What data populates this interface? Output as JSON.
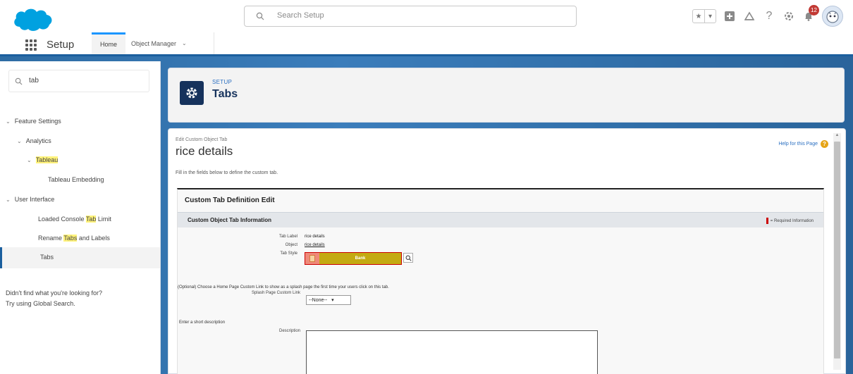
{
  "search": {
    "placeholder": "Search Setup"
  },
  "header": {
    "notification_count": "12"
  },
  "app_nav": {
    "app_name": "Setup",
    "tabs": [
      {
        "label": "Home"
      },
      {
        "label": "Object Manager"
      }
    ]
  },
  "sidebar": {
    "quick_find_value": "tab",
    "tree": {
      "feature_settings": "Feature Settings",
      "analytics": "Analytics",
      "tableau": "Tableau",
      "tableau_embedding": "Tableau Embedding",
      "user_interface": "User Interface",
      "loaded_console_prefix": "Loaded Console ",
      "loaded_console_hl": "Tab",
      "loaded_console_suffix": " Limit",
      "rename_prefix": "Rename ",
      "rename_hl": "Tabs",
      "rename_suffix": " and Labels",
      "tabs": "Tabs"
    },
    "help_line1": "Didn't find what you're looking for?",
    "help_line2": "Try using Global Search."
  },
  "setup_header": {
    "kicker": "SETUP",
    "title": "Tabs"
  },
  "content": {
    "breadcrumb": "Edit Custom Object Tab",
    "page_title": "rice details",
    "help_link": "Help for this Page",
    "instructions": "Fill in the fields below to define the custom tab.",
    "edit_title": "Custom Tab Definition Edit",
    "section_title": "Custom Object Tab Information",
    "required_info": "= Required Information",
    "fields": {
      "tab_label_label": "Tab Label",
      "tab_label_value": "rice details",
      "object_label": "Object",
      "object_value": "rice details",
      "tab_style_label": "Tab Style",
      "tab_style_value": "Bank"
    },
    "optional_text": "(Optional) Choose a Home Page Custom Link to show as a splash page the first time your users click on this tab.",
    "splash_label": "Splash Page Custom Link",
    "splash_value": "--None--",
    "short_desc": "Enter a short description",
    "description_label": "Description"
  },
  "colors": {
    "brand": "#1b96ff",
    "nav_band": "#1b5f9e",
    "setup_icon_bg": "#16325c",
    "tab_style_color": "#c4aa12",
    "highlight": "#fff27a"
  }
}
